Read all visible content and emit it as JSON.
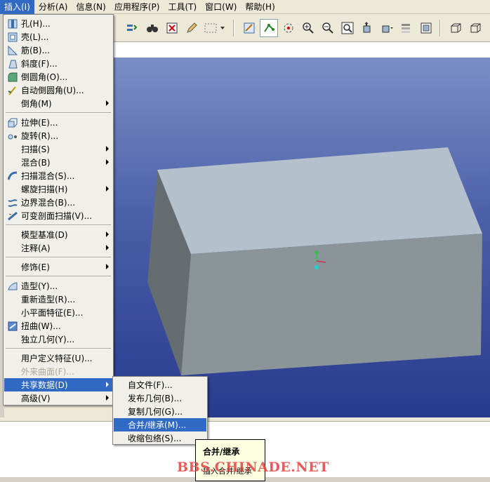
{
  "menubar": {
    "items": [
      "插入(I)",
      "分析(A)",
      "信息(N)",
      "应用程序(P)",
      "工具(T)",
      "窗口(W)",
      "帮助(H)"
    ]
  },
  "insert_menu": {
    "items": [
      {
        "label": "孔(H)...",
        "icon": "hole-icon"
      },
      {
        "label": "壳(L)...",
        "icon": "shell-icon"
      },
      {
        "label": "筋(B)...",
        "icon": "rib-icon"
      },
      {
        "label": "斜度(F)...",
        "icon": "draft-icon"
      },
      {
        "label": "倒圆角(O)...",
        "icon": "round-icon"
      },
      {
        "label": "自动倒圆角(U)...",
        "icon": "auto-round-icon"
      },
      {
        "label": "倒角(M)",
        "icon": "",
        "submenu": true
      },
      {
        "label": "拉伸(E)...",
        "icon": "extrude-icon"
      },
      {
        "label": "旋转(R)...",
        "icon": "revolve-icon"
      },
      {
        "label": "扫描(S)",
        "icon": "",
        "submenu": true
      },
      {
        "label": "混合(B)",
        "icon": "",
        "submenu": true
      },
      {
        "label": "扫描混合(S)...",
        "icon": "swept-blend-icon"
      },
      {
        "label": "螺旋扫描(H)",
        "icon": "",
        "submenu": true
      },
      {
        "label": "边界混合(B)...",
        "icon": "boundary-blend-icon"
      },
      {
        "label": "可变剖面扫描(V)...",
        "icon": "variable-sweep-icon"
      },
      {
        "label": "模型基准(D)",
        "icon": "",
        "submenu": true
      },
      {
        "label": "注释(A)",
        "icon": "",
        "submenu": true
      },
      {
        "label": "修饰(E)",
        "icon": "",
        "submenu": true
      },
      {
        "label": "造型(Y)...",
        "icon": "style-icon"
      },
      {
        "label": "重新造型(R)...",
        "icon": ""
      },
      {
        "label": "小平面特征(E)...",
        "icon": ""
      },
      {
        "label": "扭曲(W)...",
        "icon": "warp-icon"
      },
      {
        "label": "独立几何(Y)...",
        "icon": ""
      },
      {
        "label": "用户定义特征(U)...",
        "icon": ""
      },
      {
        "label": "外来曲面(F)...",
        "icon": "",
        "disabled": true
      },
      {
        "label": "共享数据(D)",
        "icon": "",
        "submenu": true,
        "highlighted": true
      },
      {
        "label": "高级(V)",
        "icon": "",
        "submenu": true
      }
    ]
  },
  "share_submenu": {
    "items": [
      {
        "label": "自文件(F)..."
      },
      {
        "label": "发布几何(B)..."
      },
      {
        "label": "复制几何(G)..."
      },
      {
        "label": "合并/继承(M)...",
        "highlighted": true
      },
      {
        "label": "收缩包络(S)..."
      }
    ]
  },
  "tooltip": {
    "title": "合并/继承",
    "description": "插入合并/继承"
  },
  "watermark": "BBS.CHINADE.NET",
  "colors": {
    "highlight": "#316ac5",
    "viewport_top": "#7a8ec6",
    "viewport_bottom": "#283a8e",
    "box_top": "#b4c0cc",
    "box_front": "#8a9499",
    "box_side": "#656d70"
  }
}
